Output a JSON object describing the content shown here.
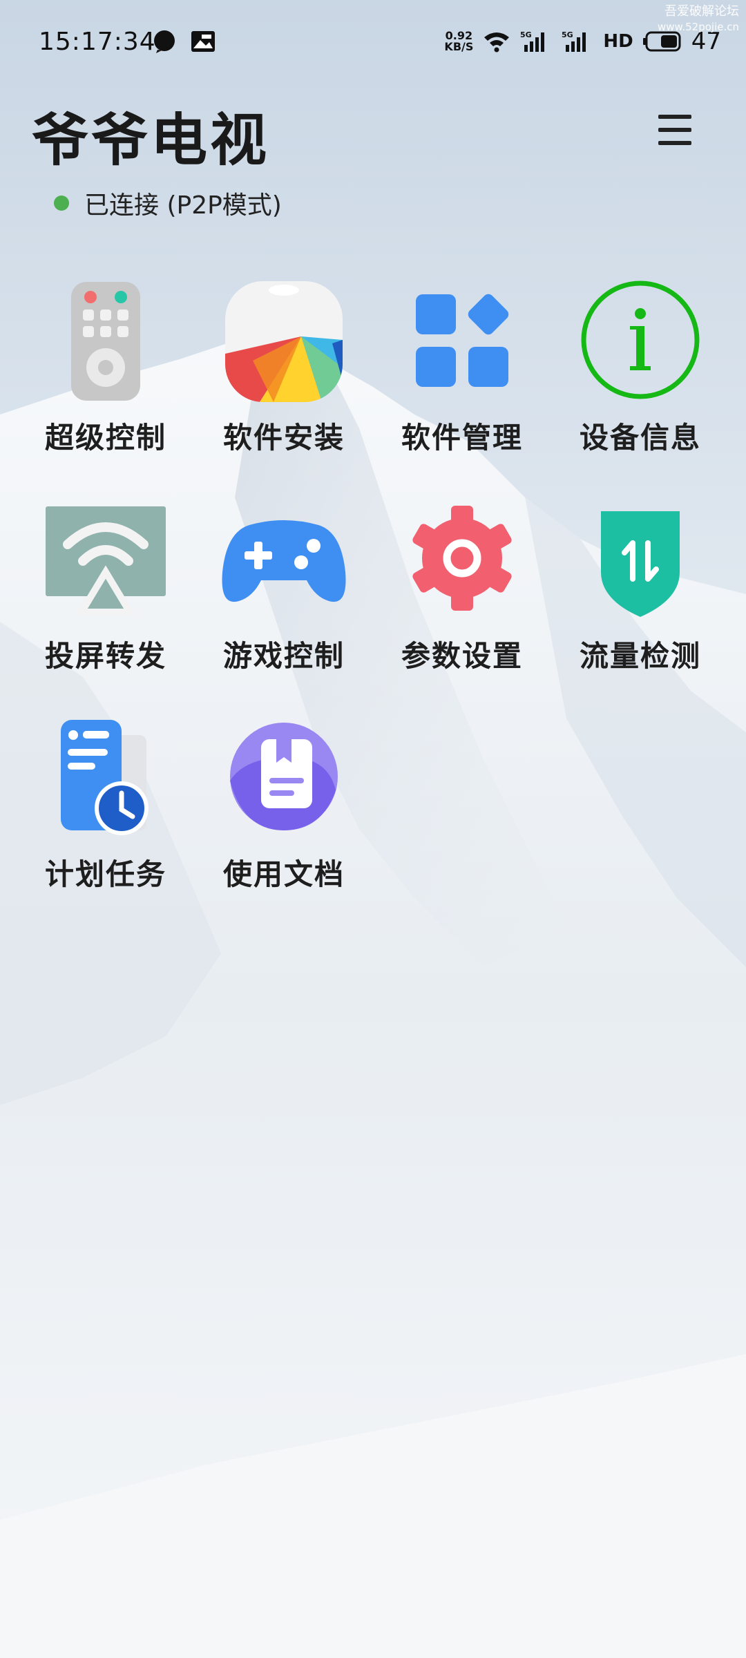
{
  "status_bar": {
    "time": "15:17:34",
    "net_speed_value": "0.92",
    "net_speed_unit": "KB/S",
    "hd_label": "HD",
    "battery": "47",
    "watermark_line1": "吾爱破解论坛",
    "watermark_line2": "www.52pojie.cn"
  },
  "header": {
    "title": "爷爷电视",
    "connection_status": "已连接 (P2P模式)",
    "status_color": "#4cb050"
  },
  "menu": {
    "icon": "hamburger-menu-icon"
  },
  "grid": {
    "items": [
      {
        "label": "超级控制",
        "icon": "remote-control-icon"
      },
      {
        "label": "软件安装",
        "icon": "app-install-icon"
      },
      {
        "label": "软件管理",
        "icon": "app-manage-icon"
      },
      {
        "label": "设备信息",
        "icon": "info-icon"
      },
      {
        "label": "投屏转发",
        "icon": "screen-cast-icon"
      },
      {
        "label": "游戏控制",
        "icon": "gamepad-icon"
      },
      {
        "label": "参数设置",
        "icon": "settings-gear-icon"
      },
      {
        "label": "流量检测",
        "icon": "traffic-shield-icon"
      },
      {
        "label": "计划任务",
        "icon": "scheduled-task-icon"
      },
      {
        "label": "使用文档",
        "icon": "document-icon"
      }
    ]
  }
}
